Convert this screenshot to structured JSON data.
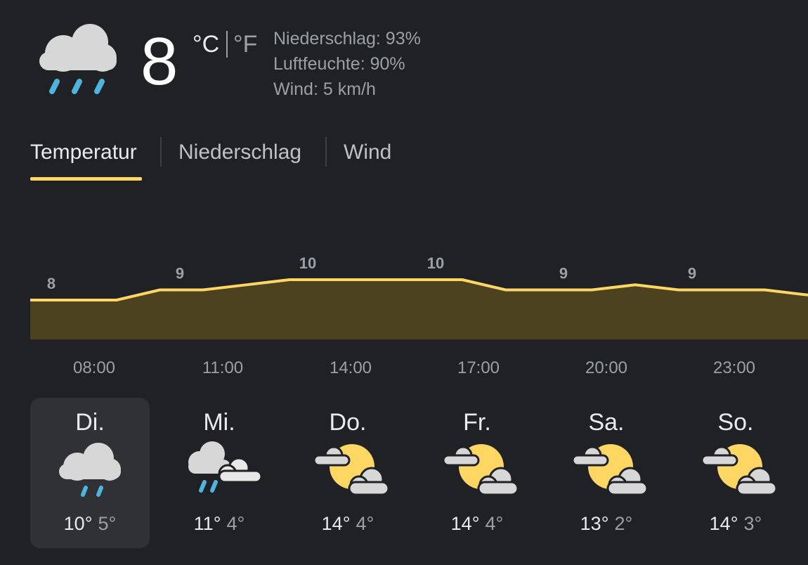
{
  "current": {
    "icon": "rain-cloud-icon",
    "temperature": "8",
    "unit_c": "°C",
    "unit_f": "°F",
    "details": [
      "Niederschlag: 93%",
      "Luftfeuchte: 90%",
      "Wind: 5 km/h"
    ]
  },
  "tabs": [
    "Temperatur",
    "Niederschlag",
    "Wind"
  ],
  "active_tab": "Temperatur",
  "chart_data": {
    "type": "area",
    "series": [
      {
        "values": [
          8,
          8,
          8,
          9,
          9,
          9.5,
          10,
          10,
          10,
          10,
          10,
          9,
          9,
          9,
          9.5,
          9,
          9,
          9,
          8.5
        ]
      }
    ],
    "value_labels": [
      "8",
      "9",
      "10",
      "10",
      "9",
      "9"
    ],
    "time_labels": [
      "08:00",
      "11:00",
      "14:00",
      "17:00",
      "20:00",
      "23:00"
    ],
    "line_color": "#fdd663",
    "fill_color": "#4d4220"
  },
  "days": [
    {
      "name": "Di.",
      "high": "10°",
      "low": "5°",
      "icon": "rain-cloud-icon"
    },
    {
      "name": "Mi.",
      "high": "11°",
      "low": "4°",
      "icon": "rain-clouds-icon"
    },
    {
      "name": "Do.",
      "high": "14°",
      "low": "4°",
      "icon": "partly-cloudy-icon"
    },
    {
      "name": "Fr.",
      "high": "14°",
      "low": "4°",
      "icon": "partly-cloudy-icon"
    },
    {
      "name": "Sa.",
      "high": "13°",
      "low": "2°",
      "icon": "partly-cloudy-icon"
    },
    {
      "name": "So.",
      "high": "14°",
      "low": "3°",
      "icon": "partly-cloudy-icon"
    }
  ]
}
